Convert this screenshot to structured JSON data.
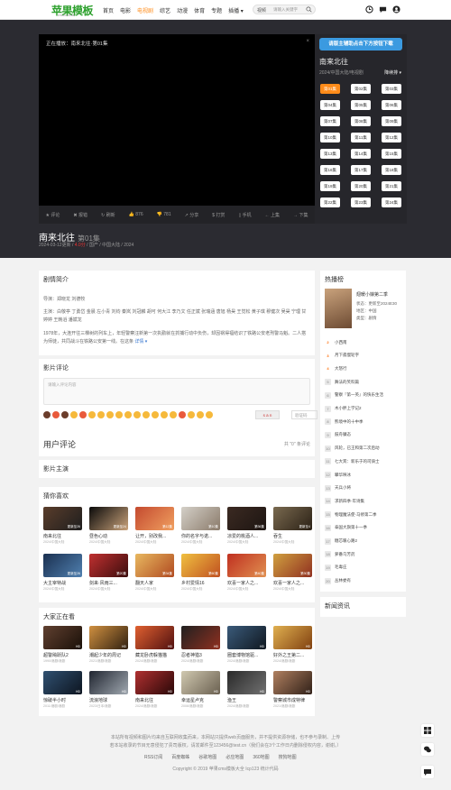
{
  "header": {
    "logo": "苹果模板",
    "logo_sub": "PINGGUOMB",
    "nav": [
      "首页",
      "电影",
      "电视剧",
      "综艺",
      "动漫",
      "体育",
      "专题",
      "插播"
    ],
    "nav_active": "电视剧",
    "search_select": "视频",
    "search_placeholder": "请输入关键字"
  },
  "player": {
    "now_playing": "正在播放：南来北往·第01集",
    "close": "×",
    "controls": [
      "评论",
      "报错",
      "刷新",
      "876",
      "781",
      "分享",
      "打赏",
      "手机",
      "上集",
      "下集"
    ]
  },
  "side": {
    "download_btn": "请版主辅助点击下方按钮下载",
    "title": "南来北往",
    "meta": "2024/中国大陆/电视剧",
    "sort": "降续排",
    "episodes": [
      "第01集",
      "第02集",
      "第03集",
      "第04集",
      "第05集",
      "第06集",
      "第07集",
      "第08集",
      "第09集",
      "第10集",
      "第11集",
      "第12集",
      "第13集",
      "第14集",
      "第15集",
      "第16集",
      "第17集",
      "第18集",
      "第19集",
      "第20集",
      "第21集",
      "第22集",
      "第23集",
      "第24集"
    ]
  },
  "show": {
    "title": "南来北往",
    "episode": "第01集",
    "meta_a": "2024-03-12更新 / ",
    "meta_b": "4.0分",
    "meta_c": " / 国产 / 中国大陆 / 2024"
  },
  "intro": {
    "heading": "剧情简介",
    "director": "导演：郑晓龙 刘德牧",
    "cast": "主演：白敬亭 丁勇岱 金晨 左小青 刘钧 秦岚 刘冠麟 胡可 何大江 李乃文 任正斌 张瑞涵 唐旭 杨昊 王觉松 黄子琪 穆健次 吴昊 宁理 甘婷婷 王韩滔 潘斌龙",
    "text": "1978年，大连开往三棵树的列车上，年轻警察汪新第一次执勤就在抓捕行动中负伤，却因祸得福结识了铁路公安老刑警马魁。二人搭为师徒，共同战斗在铁路公安第一线。在这条",
    "more": "详情"
  },
  "comment": {
    "heading": "影片评论",
    "placeholder": "请输入评论内容",
    "captcha": "s a n",
    "captcha_placeholder": "验证码",
    "send": "发表",
    "user_heading": "用户评论",
    "count": "共 \"0\" 条评论"
  },
  "cast_heading": "影片主演",
  "recommend": {
    "heading": "猜你喜欢",
    "items": [
      {
        "name": "南来北往",
        "info": "2024/中国大陆",
        "tag": "更新至26",
        "c1": "#5a3d2b",
        "c2": "#1e1e1e"
      },
      {
        "name": "昼色心动",
        "info": "2024/中国大陆",
        "tag": "更新至24",
        "c1": "#0a0a0a",
        "c2": "#c9a27a"
      },
      {
        "name": "让开，别改我...",
        "info": "2024/中国大陆",
        "tag": "第12集",
        "c1": "#c44a2f",
        "c2": "#f0a060"
      },
      {
        "name": "你的名字与诺...",
        "info": "2024/中国大陆",
        "tag": "第10集",
        "c1": "#d4d0c8",
        "c2": "#8a7a6a"
      },
      {
        "name": "凉爱的桃酒人...",
        "info": "2024/中国大陆",
        "tag": "第36集",
        "c1": "#3b2a22",
        "c2": "#1d1512"
      },
      {
        "name": "吞生",
        "info": "2024/中国大陆",
        "tag": "更新至4",
        "c1": "#7a6a50",
        "c2": "#2a2015"
      },
      {
        "name": "大主宰特战",
        "info": "2024/中国大陆",
        "tag": "更新至26",
        "c1": "#1a3050",
        "c2": "#5080b0"
      },
      {
        "name": "剑来·风雨三...",
        "info": "2024/中国大陆",
        "tag": "第20集",
        "c1": "#c03030",
        "c2": "#3b0d0d"
      },
      {
        "name": "翻天人家",
        "info": "2024/中国大陆",
        "tag": "第34集",
        "c1": "#e8b860",
        "c2": "#b04a20"
      },
      {
        "name": "乡村爱情16",
        "info": "2024/中国大陆",
        "tag": "第60集",
        "c1": "#f0c040",
        "c2": "#c05020"
      },
      {
        "name": "欢喜一家人之...",
        "info": "2024/中国大陆",
        "tag": "第40集",
        "c1": "#c03020",
        "c2": "#e09050"
      },
      {
        "name": "欢喜一家人之...",
        "info": "2024/中国大陆",
        "tag": "第30集",
        "c1": "#d0a040",
        "c2": "#903020"
      }
    ]
  },
  "watching": {
    "heading": "大家正在看",
    "items": [
      {
        "name": "超警飚跃队2",
        "info": "1990/港剧/港剧",
        "tag": "HD",
        "c1": "#604030",
        "c2": "#1a1008"
      },
      {
        "name": "潮起少年的周记",
        "info": "2021/港剧/港剧",
        "tag": "HD",
        "c1": "#d09040",
        "c2": "#302010"
      },
      {
        "name": "藏龙卧虎躲猫猫",
        "info": "2024/港剧/港剧",
        "tag": "HD",
        "c1": "#e06030",
        "c2": "#501010"
      },
      {
        "name": "忍者神猎3",
        "info": "2024/港剧/港剧",
        "tag": "HD",
        "c1": "#202020",
        "c2": "#903020"
      },
      {
        "name": "圈套博物馆驱...",
        "info": "2024/港剧/港剧",
        "tag": "HD",
        "c1": "#3a5a7a",
        "c2": "#101820"
      },
      {
        "name": "好外之王第二...",
        "info": "2024/港剧/港剧",
        "tag": "HD",
        "c1": "#e0b050",
        "c2": "#804010"
      },
      {
        "name": "惊破半小时",
        "info": "2011/港剧/港剧",
        "tag": "HD",
        "c1": "#305070",
        "c2": "#0d1520"
      },
      {
        "name": "流浪地球",
        "info": "2023/日本/港剧",
        "tag": "HD",
        "c1": "#202530",
        "c2": "#a0a8b0"
      },
      {
        "name": "南来北往",
        "info": "2024/港剧/港剧",
        "tag": "HD",
        "c1": "#b03030",
        "c2": "#2a0808"
      },
      {
        "name": "幸运星卢克",
        "info": "2006/港剧/港剧",
        "tag": "HD",
        "c1": "#d0c8b0",
        "c2": "#6a6050"
      },
      {
        "name": "渔王",
        "info": "2024/港剧/港剧",
        "tag": "HD",
        "c1": "#2a2a2a",
        "c2": "#707070"
      },
      {
        "name": "警察城市成特律",
        "info": "2021/港剧/港剧",
        "tag": "HD",
        "c1": "#b08060",
        "c2": "#302018"
      }
    ]
  },
  "hot": {
    "heading": "热播榜",
    "top_name": "翅暖小娘第二季",
    "top_lines": [
      "状态：更新至2024E30",
      "地区：中国",
      "类型：剧情"
    ],
    "list": [
      "小西南",
      "月下孤慢轮字",
      "大怒行",
      "舞法的笑料篇",
      "警察『第一英』的快乐生活",
      "木小胖上学记2",
      "熊境中的十中季",
      "鼓舟镰态",
      "风轮，已王和第二次后动",
      "七大宾：新乐于的司骑士",
      "攀华映冰",
      "天兵小将",
      "求新四季·年诗集",
      "物理魔法使·马修第二季",
      "泰国大旗第十一季",
      "糖芯暖心路2",
      "萝番乌芳药",
      "毛毒庄",
      "丛林委有"
    ]
  },
  "news_heading": "新闻资讯",
  "footer": {
    "line1": "本站所有视频和图片均来自互联网收集而来，本网站只提供web页面服务，并不提供资源存储，也不参与录制、上传",
    "line2": "若本站收录的节目无意侵犯了贵司版权，请发邮件至123456@test.cn（我们会在3个工作日内删除侵权内容，谢谢。）",
    "links": [
      "RSS订阅",
      "百度蜘蛛",
      "谷歌地图",
      "必应地图",
      "360地图",
      "搜狗地图"
    ],
    "copyright": "Copyright © 2019 苹果cms模板大全 Icp123 统计代码"
  }
}
